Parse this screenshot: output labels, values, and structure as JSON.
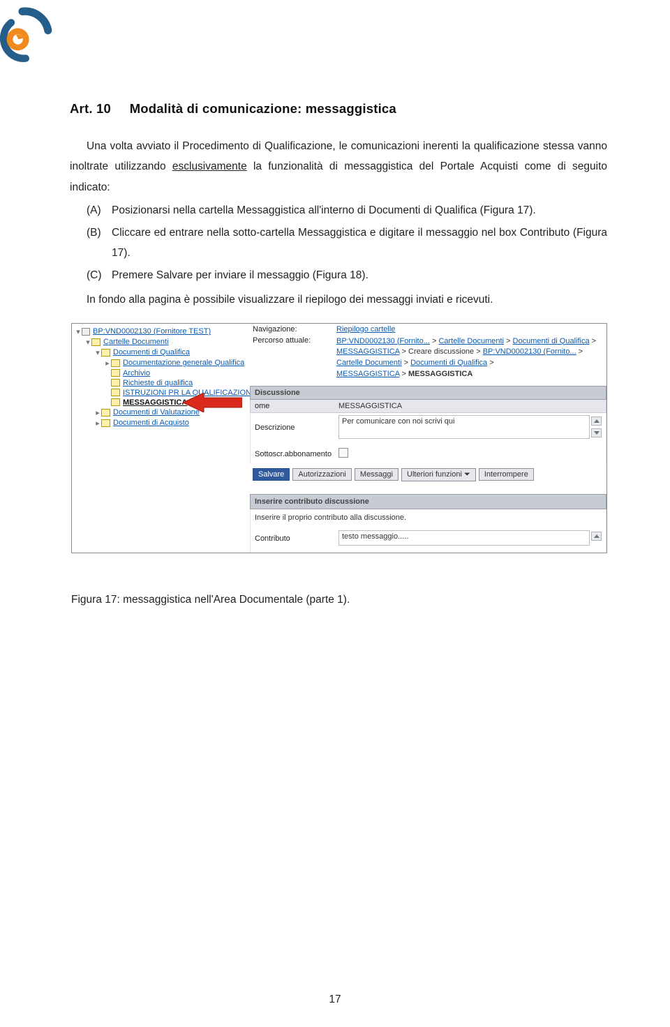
{
  "heading": {
    "label_prefix": "Art. 10",
    "label_rest": "Modalità di comunicazione: messaggistica"
  },
  "intro": {
    "p1_a": "Una volta avviato il Procedimento di Qualificazione, le comunicazioni inerenti la qualificazione stessa vanno inoltrate utilizzando ",
    "p1_b": "esclusivamente",
    "p1_c": " la funzionalità di messaggistica del Portale Acquisti come di seguito indicato:"
  },
  "list": {
    "a": {
      "marker": "(A)",
      "text": "Posizionarsi nella cartella Messaggistica all'interno di Documenti di Qualifica (Figura 17)."
    },
    "b": {
      "marker": "(B)",
      "text": "Cliccare ed entrare nella sotto-cartella Messaggistica e digitare il messaggio nel box Contributo (Figura 17)."
    },
    "c": {
      "marker": "(C)",
      "text": "Premere Salvare per inviare il messaggio (Figura 18)."
    }
  },
  "epilogue": "In fondo alla pagina è possibile visualizzare il riepilogo dei messaggi inviati e ricevuti.",
  "tree": {
    "root": "BP:VND0002130 (Fornitore TEST)",
    "n1": "Cartelle Documenti",
    "n2": "Documenti di Qualifica",
    "n3": "Documentazione generale Qualifica",
    "n4": "Archivio",
    "n5": "Richieste di qualifica",
    "n6": "ISTRUZIONI PR LA QUALIFICAZIONE",
    "n7": "MESSAGGISTICA",
    "n8": "Documenti di Valutazione",
    "n9": "Documenti di Acquisto"
  },
  "form": {
    "nav_label": "Navigazione:",
    "nav_value": "Riepilogo cartelle",
    "path_label": "Percorso attuale:",
    "path_parts": {
      "a": "BP:VND0002130 (Fornito...",
      "b": "Cartelle Documenti",
      "c": "Documenti di Qualifica",
      "d": "MESSAGGISTICA",
      "e": "Creare discussione",
      "f": "BP:VND0002130 (Fornito...",
      "g": "Cartelle Documenti",
      "h": "Documenti di Qualifica",
      "i": "MESSAGGISTICA",
      "j": "MESSAGGISTICA"
    },
    "gt": " > ",
    "band_discussione": "Discussione",
    "row_nome": {
      "label": "ome",
      "value": "MESSAGGISTICA"
    },
    "row_descr": {
      "label": "Descrizione",
      "value": "Per comunicare con noi scrivi qui"
    },
    "row_sub": {
      "label": "Sottoscr.abbonamento"
    },
    "buttons": {
      "salvare": "Salvare",
      "autorizzazioni": "Autorizzazioni",
      "messaggi": "Messaggi",
      "ulteriori": "Ulteriori funzioni ⏷",
      "interrompere": "Interrompere"
    },
    "band_inserire": "Inserire contributo discussione",
    "note": "Inserire il proprio contributo alla discussione.",
    "row_contrib": {
      "label": "Contributo",
      "value": "testo messaggio....."
    }
  },
  "caption": "Figura 17: messaggistica nell'Area Documentale (parte 1).",
  "page_number": "17"
}
